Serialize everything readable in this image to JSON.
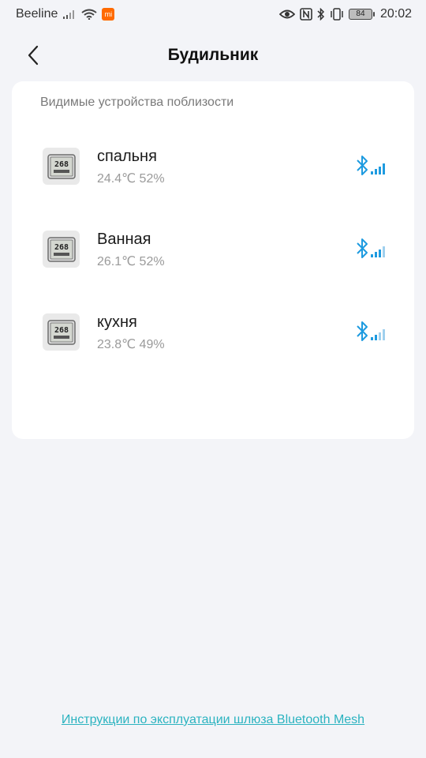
{
  "status_bar": {
    "carrier": "Beeline",
    "battery": "84",
    "time": "20:02",
    "icons": [
      "signal-icon",
      "wifi-icon",
      "mi-app-icon",
      "eye-icon",
      "nfc-icon",
      "bluetooth-icon",
      "vibrate-icon",
      "battery-icon"
    ]
  },
  "header": {
    "title": "Будильник",
    "back_icon": "chevron-left-icon"
  },
  "devices_section": {
    "label": "Видимые устройства поблизости",
    "devices": [
      {
        "name": "спальня",
        "reading": "24.4℃ 52%",
        "icon": "thermometer-hygrometer-icon",
        "signal_icon": "bluetooth-signal-icon"
      },
      {
        "name": "Ванная",
        "reading": "26.1℃ 52%",
        "icon": "thermometer-hygrometer-icon",
        "signal_icon": "bluetooth-signal-icon"
      },
      {
        "name": "кухня",
        "reading": "23.8℃ 49%",
        "icon": "thermometer-hygrometer-icon",
        "signal_icon": "bluetooth-signal-icon"
      }
    ]
  },
  "footer": {
    "link": "Инструкции по эксплуатации шлюза Bluetooth Mesh"
  },
  "colors": {
    "background": "#f3f4f8",
    "card": "#ffffff",
    "link": "#2bb3c0",
    "bluetooth": "#1e9be0"
  }
}
